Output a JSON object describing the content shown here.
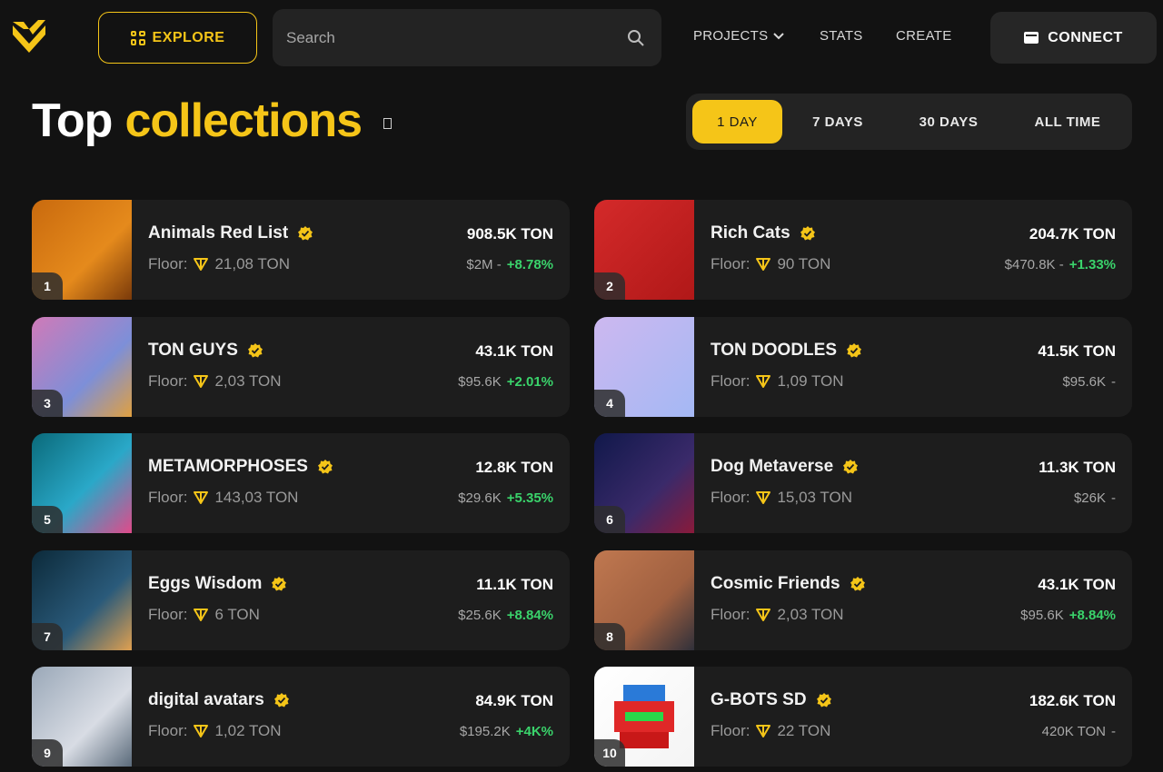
{
  "header": {
    "explore_label": "EXPLORE",
    "search_placeholder": "Search",
    "nav": {
      "projects": "PROJECTS",
      "stats": "STATS",
      "create": "CREATE"
    },
    "connect_label": "CONNECT"
  },
  "title": {
    "part1": "Top",
    "part2": "collections"
  },
  "period_tabs": [
    "1 DAY",
    "7 DAYS",
    "30 DAYS",
    "ALL TIME"
  ],
  "active_period": "1 DAY",
  "floor_label": "Floor:",
  "collections": [
    {
      "rank": "1",
      "name": "Animals Red List",
      "floor": "21,08 TON",
      "volume": "908.5K TON",
      "usd": "$2M -",
      "change": "+8.78%"
    },
    {
      "rank": "2",
      "name": "Rich Cats",
      "floor": "90 TON",
      "volume": "204.7K TON",
      "usd": "$470.8K -",
      "change": "+1.33%"
    },
    {
      "rank": "3",
      "name": "TON GUYS",
      "floor": "2,03 TON",
      "volume": "43.1K TON",
      "usd": "$95.6K",
      "change": "+2.01%"
    },
    {
      "rank": "4",
      "name": "TON DOODLES",
      "floor": "1,09 TON",
      "volume": "41.5K TON",
      "usd": "$95.6K",
      "change": "-"
    },
    {
      "rank": "5",
      "name": "METAMORPHOSES",
      "floor": "143,03 TON",
      "volume": "12.8K TON",
      "usd": "$29.6K",
      "change": "+5.35%"
    },
    {
      "rank": "6",
      "name": "Dog Metaverse",
      "floor": "15,03 TON",
      "volume": "11.3K TON",
      "usd": "$26K",
      "change": "-"
    },
    {
      "rank": "7",
      "name": "Eggs Wisdom",
      "floor": "6 TON",
      "volume": "11.1K TON",
      "usd": "$25.6K",
      "change": "+8.84%"
    },
    {
      "rank": "8",
      "name": "Cosmic Friends",
      "floor": "2,03 TON",
      "volume": "43.1K TON",
      "usd": "$95.6K",
      "change": "+8.84%"
    },
    {
      "rank": "9",
      "name": "digital avatars",
      "floor": "1,02 TON",
      "volume": "84.9K TON",
      "usd": "$195.2K",
      "change": "+4K%"
    },
    {
      "rank": "10",
      "name": "G-BOTS SD",
      "floor": "22 TON",
      "volume": "182.6K TON",
      "usd": "420K TON",
      "change": "-"
    }
  ],
  "colors": {
    "accent": "#f5c518",
    "positive": "#3ad36b",
    "background": "#121212",
    "card": "#1d1d1d"
  },
  "icons": [
    "logo-icon",
    "grid-icon",
    "search-icon",
    "chevron-down-icon",
    "wallet-icon",
    "info-icon",
    "verified-icon",
    "ton-icon"
  ]
}
